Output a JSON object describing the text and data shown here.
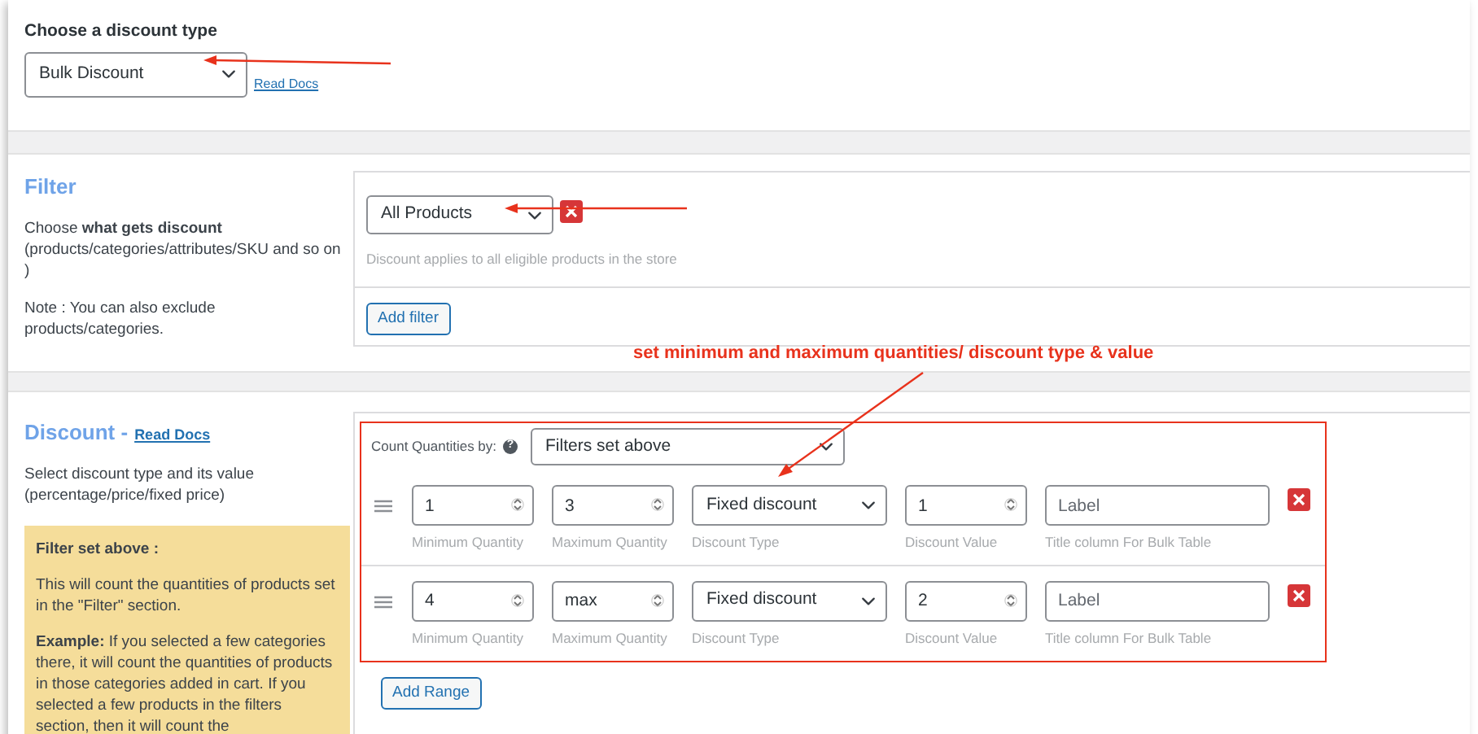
{
  "discount_type": {
    "label": "Choose a discount type",
    "value": "Bulk Discount",
    "link": "Read Docs"
  },
  "filter": {
    "title": "Filter",
    "description": "Choose **what gets discount** (products/categories/attributes/SKU and so on )",
    "note": "Note : You can also exclude products/categories.",
    "select": "All Products",
    "help": "Discount applies to all eligible products in the store",
    "button": "Add filter"
  },
  "annotation": "set minimum and maximum quantities/ discount type & value",
  "discount": {
    "title": "Discount -",
    "link": "Read Docs",
    "description": "Select discount type and its value (percentage/price/fixed price)",
    "info": {
      "title": "Filter set above :",
      "paragraphs": [
        "This will count the quantities of products set in the \"Filter\" section.",
        "**Example:** If you selected a few categories there, it will count the quantities of products in those categories added in cart. If you selected a few products in the filters section, then it will count the"
      ]
    },
    "count_label": "Count Quantities by:",
    "count_help": "?",
    "count_value": "Filters set above",
    "ranges": [
      {
        "min": "1",
        "max": "3",
        "type": "Fixed discount",
        "value": "1",
        "label_placeholder": "Label",
        "captions": [
          "Minimum Quantity",
          "Maximum Quantity",
          "Discount Type",
          "Discount Value",
          "Title column For Bulk Table"
        ]
      },
      {
        "min": "4",
        "max": "max",
        "type": "Fixed discount",
        "value": "2",
        "label_placeholder": "Label",
        "captions": [
          "Minimum Quantity",
          "Maximum Quantity",
          "Discount Type",
          "Discount Value",
          "Title column For Bulk Table"
        ]
      }
    ],
    "button": "Add Range"
  }
}
